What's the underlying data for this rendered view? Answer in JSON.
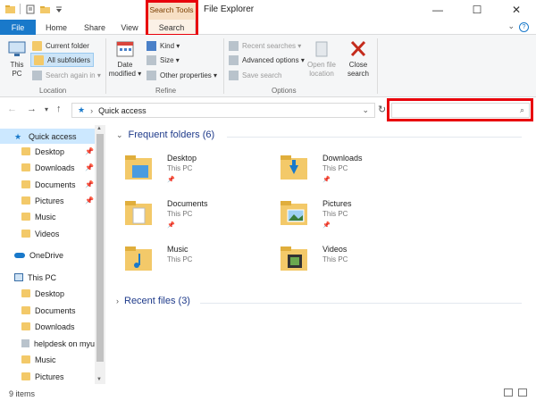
{
  "title": "File Explorer",
  "ribbon_context": {
    "label": "Search Tools"
  },
  "tabs": {
    "file": "File",
    "home": "Home",
    "share": "Share",
    "view": "View",
    "search": "Search"
  },
  "window_buttons": {
    "minimize": "—",
    "maximize": "☐",
    "close": "✕"
  },
  "ribbon": {
    "this_pc": [
      "This",
      "PC"
    ],
    "current_folder": "Current folder",
    "all_subfolders": "All subfolders",
    "search_again_in": "Search again in ▾",
    "location_label": "Location",
    "date_modified": [
      "Date",
      "modified ▾"
    ],
    "kind": "Kind ▾",
    "size": "Size ▾",
    "other_properties": "Other properties ▾",
    "refine_label": "Refine",
    "recent_searches": "Recent searches ▾",
    "advanced_options": "Advanced options ▾",
    "save_search": "Save search",
    "options_label": "Options",
    "open_file_location": [
      "Open file",
      "location"
    ],
    "close_search": [
      "Close",
      "search"
    ]
  },
  "address": {
    "location": "Quick access",
    "search_placeholder": ""
  },
  "sidebar": {
    "items": [
      {
        "label": "Quick access",
        "pinned": false
      },
      {
        "label": "Desktop",
        "pinned": true
      },
      {
        "label": "Downloads",
        "pinned": true
      },
      {
        "label": "Documents",
        "pinned": true
      },
      {
        "label": "Pictures",
        "pinned": true
      },
      {
        "label": "Music",
        "pinned": false
      },
      {
        "label": "Videos",
        "pinned": false
      },
      {
        "label": "OneDrive",
        "pinned": false
      },
      {
        "label": "This PC",
        "pinned": false
      },
      {
        "label": "Desktop",
        "pinned": false
      },
      {
        "label": "Documents",
        "pinned": false
      },
      {
        "label": "Downloads",
        "pinned": false
      },
      {
        "label": "helpdesk on myu",
        "pinned": false
      },
      {
        "label": "Music",
        "pinned": false
      },
      {
        "label": "Pictures",
        "pinned": false
      }
    ]
  },
  "main": {
    "frequent_title": "Frequent folders (6)",
    "recent_title": "Recent files (3)",
    "folders": [
      {
        "name": "Desktop",
        "location": "This PC",
        "pinned": true
      },
      {
        "name": "Downloads",
        "location": "This PC",
        "pinned": true
      },
      {
        "name": "Documents",
        "location": "This PC",
        "pinned": true
      },
      {
        "name": "Pictures",
        "location": "This PC",
        "pinned": true
      },
      {
        "name": "Music",
        "location": "This PC",
        "pinned": false
      },
      {
        "name": "Videos",
        "location": "This PC",
        "pinned": false
      }
    ]
  },
  "status": {
    "item_count": "9 items"
  },
  "colors": {
    "accent": "#1979ca",
    "highlight": "#e8000b",
    "context_tab": "#f7dfc4"
  }
}
